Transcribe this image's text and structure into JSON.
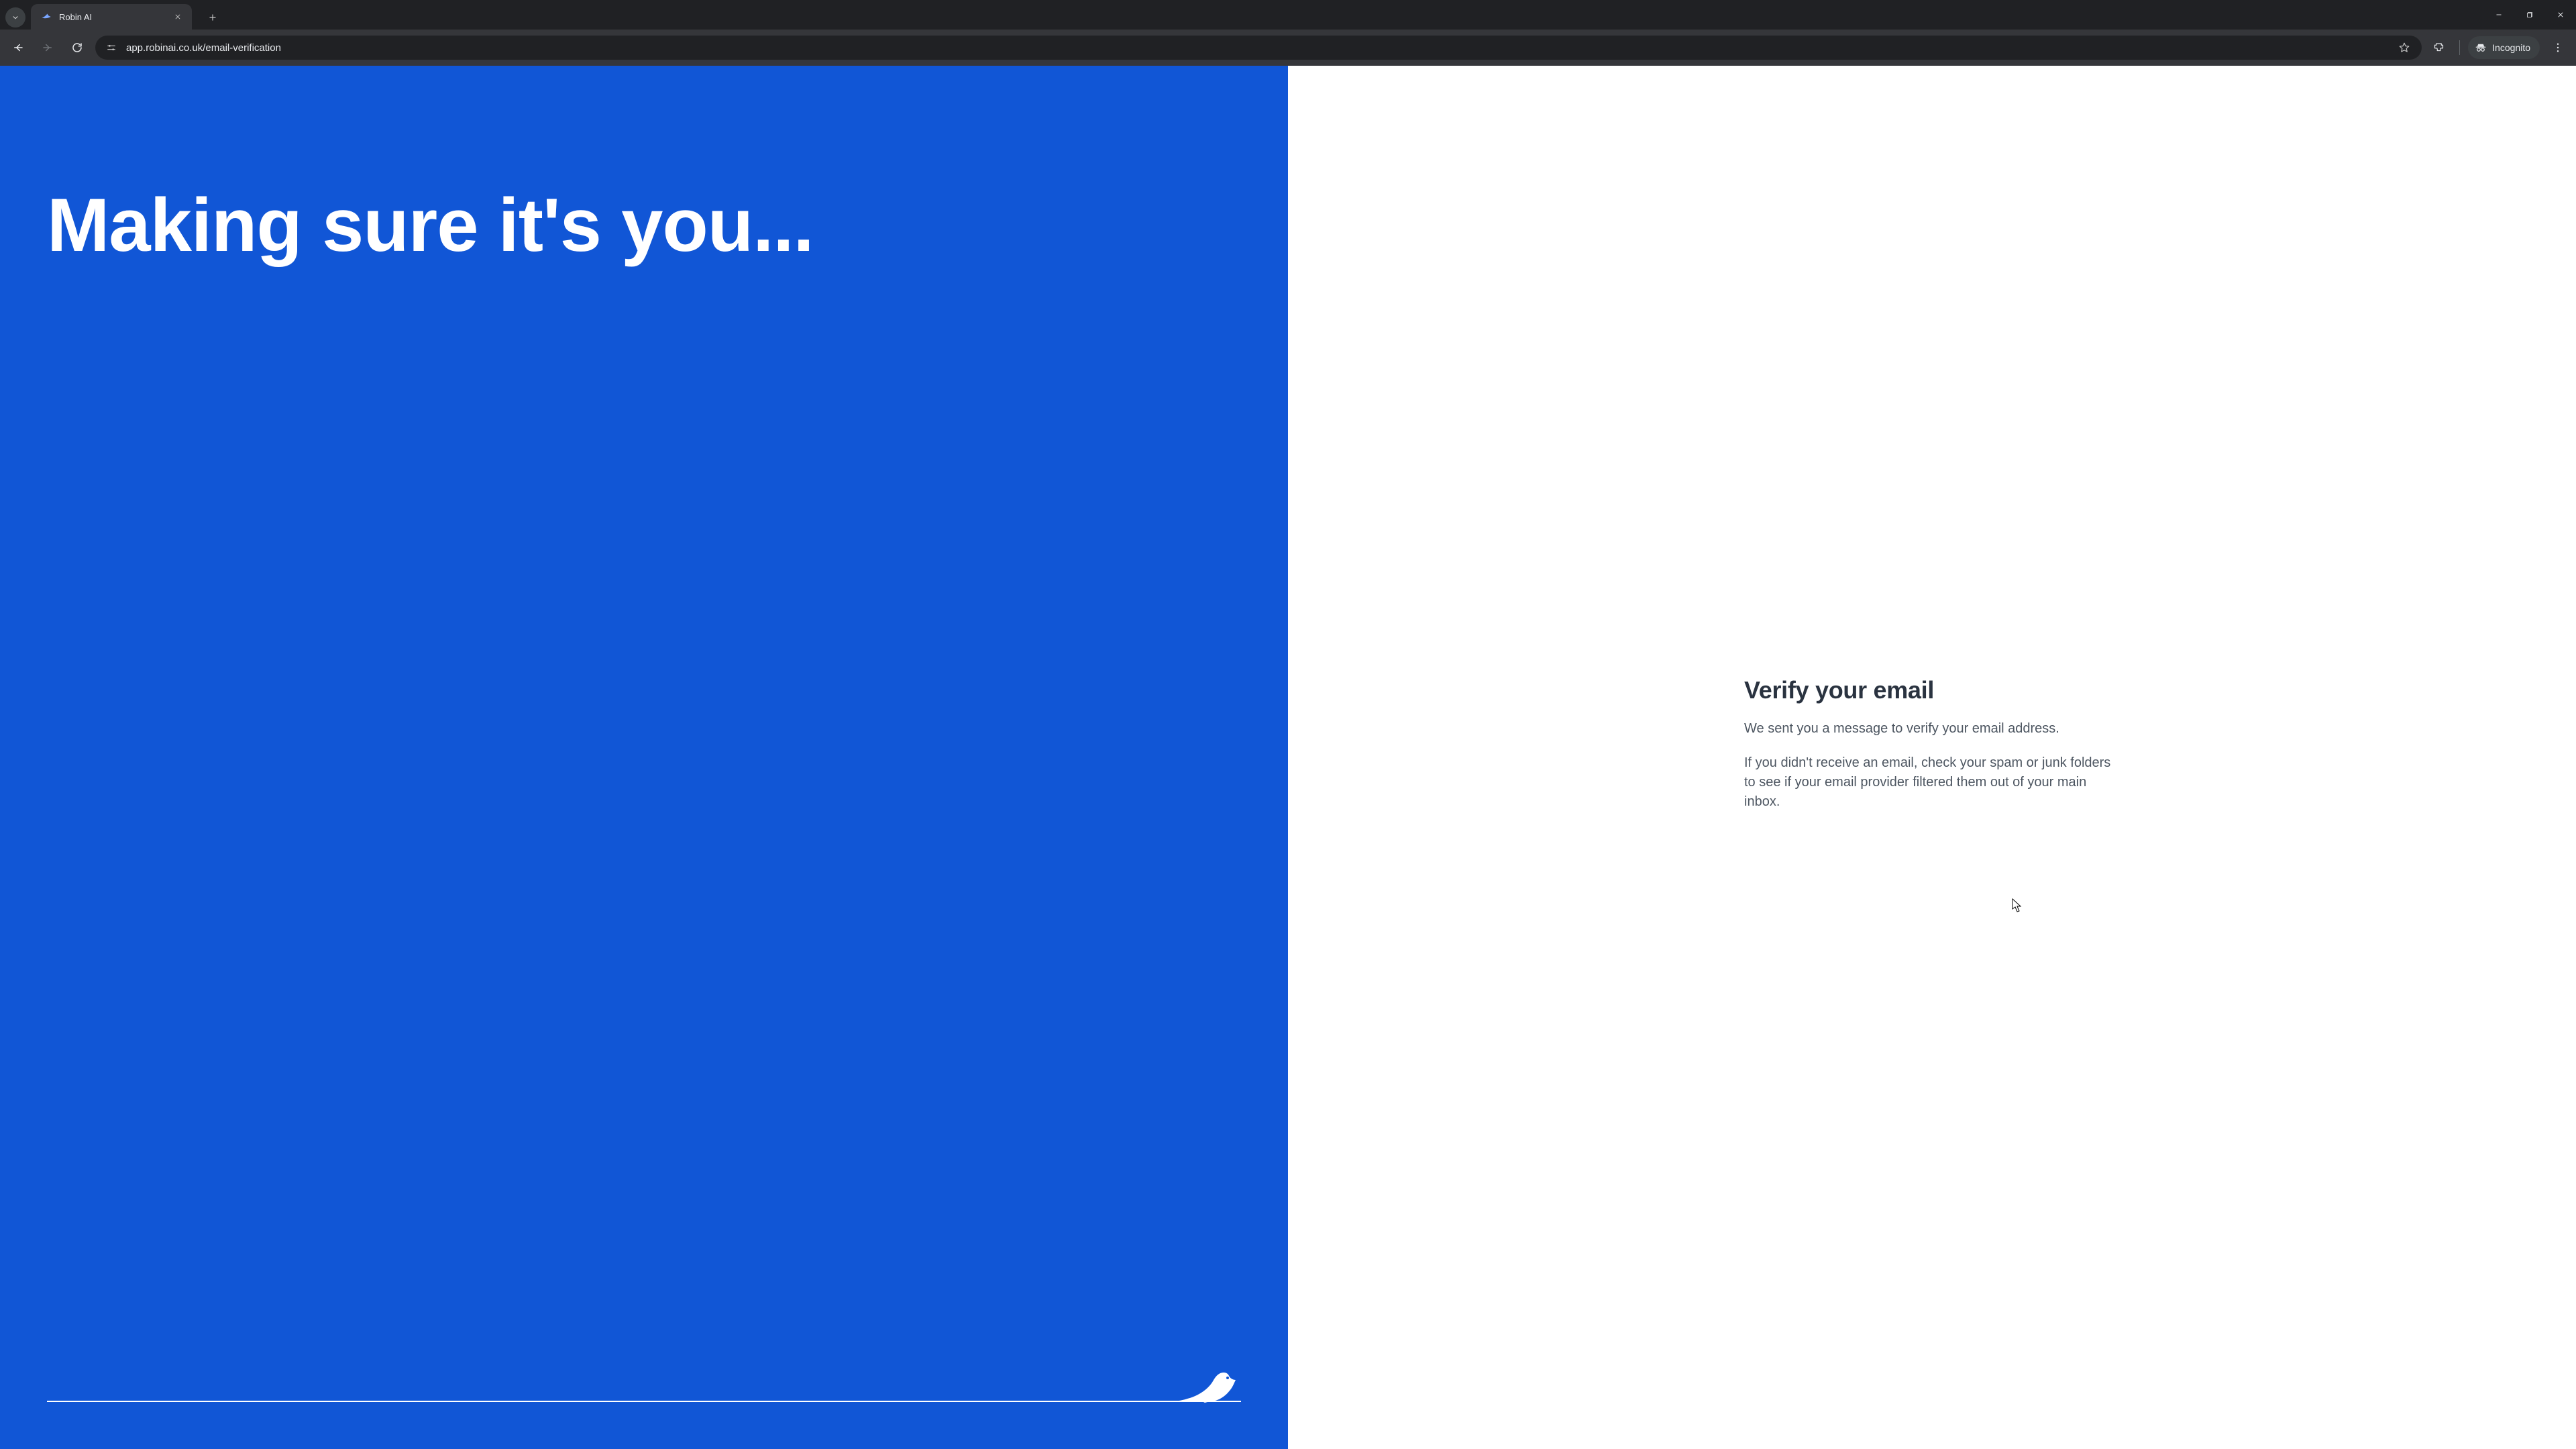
{
  "browser": {
    "tab_title": "Robin AI",
    "url": "app.robinai.co.uk/email-verification",
    "incognito_label": "Incognito"
  },
  "page": {
    "hero": "Making sure it's you...",
    "heading": "Verify your email",
    "body_line1": "We sent you a message to verify your email address.",
    "body_line2": "If you didn't receive an email, check your spam or junk folders to see if your email provider filtered them out of your main inbox."
  }
}
